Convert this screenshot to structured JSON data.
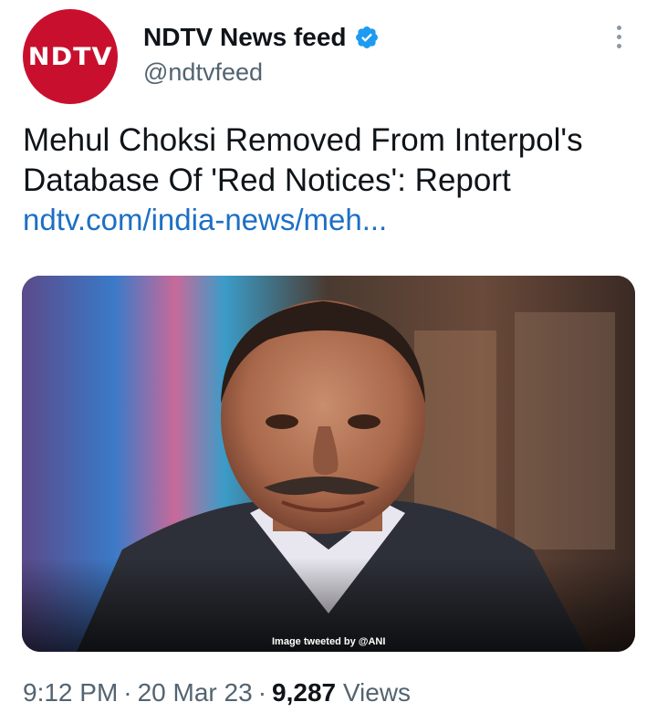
{
  "tweet": {
    "author": {
      "avatar_text": "NDTV",
      "display_name": "NDTV News feed",
      "handle": "@ndtvfeed",
      "verified_icon": "verified-badge-icon",
      "avatar_color": "#c8102e"
    },
    "headline": "Mehul Choksi Removed From Interpol's Database Of 'Red Notices': Report",
    "link_text": "ndtv.com/india-news/meh...",
    "image_credit": "Image tweeted by @ANI",
    "time": "9:12 PM",
    "date": "20 Mar 23",
    "views_count": "9,287",
    "views_label": "Views",
    "separator": "·"
  },
  "colors": {
    "link": "#1d6fc4",
    "secondary_text": "#536471",
    "verified": "#1d9bf0"
  }
}
